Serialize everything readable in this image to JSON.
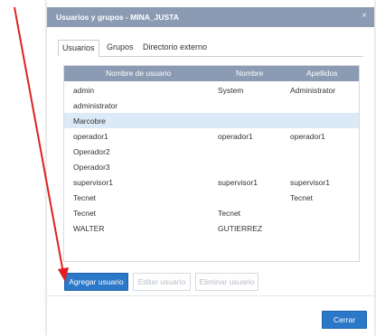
{
  "dialog": {
    "title": "Usuarios y grupos - MINA_JUSTA",
    "close_icon": "×"
  },
  "tabs": [
    {
      "label": "Usuarios",
      "active": true
    },
    {
      "label": "Grupos",
      "active": false
    },
    {
      "label": "Directorio externo",
      "active": false
    }
  ],
  "table": {
    "columns": [
      "Nombre de usuario",
      "Nombre",
      "Apellidos"
    ],
    "rows": [
      {
        "username": "admin",
        "name": "System",
        "surname": "Administrator"
      },
      {
        "username": "administrator",
        "name": "",
        "surname": ""
      },
      {
        "username": "Marcobre",
        "name": "",
        "surname": "",
        "selected": true
      },
      {
        "username": "operador1",
        "name": "operador1",
        "surname": "operador1"
      },
      {
        "username": "Operador2",
        "name": "",
        "surname": ""
      },
      {
        "username": "Operador3",
        "name": "",
        "surname": ""
      },
      {
        "username": "supervisor1",
        "name": "supervisor1",
        "surname": "supervisor1"
      },
      {
        "username": "Tecnet",
        "name": "",
        "surname": "Tecnet"
      },
      {
        "username": "Tecnet",
        "name": "Tecnet",
        "surname": ""
      },
      {
        "username": "WALTER",
        "name": "GUTIERREZ",
        "surname": ""
      }
    ]
  },
  "buttons": {
    "add_user": "Agregar usuario",
    "edit_user": "Editar usuario",
    "delete_user": "Eliminar usuario",
    "close": "Cerrar"
  },
  "colors": {
    "header": "#8a9bb3",
    "primary": "#2b77c8",
    "selected_row": "#dce9f6",
    "annotation_arrow": "#e02020"
  }
}
